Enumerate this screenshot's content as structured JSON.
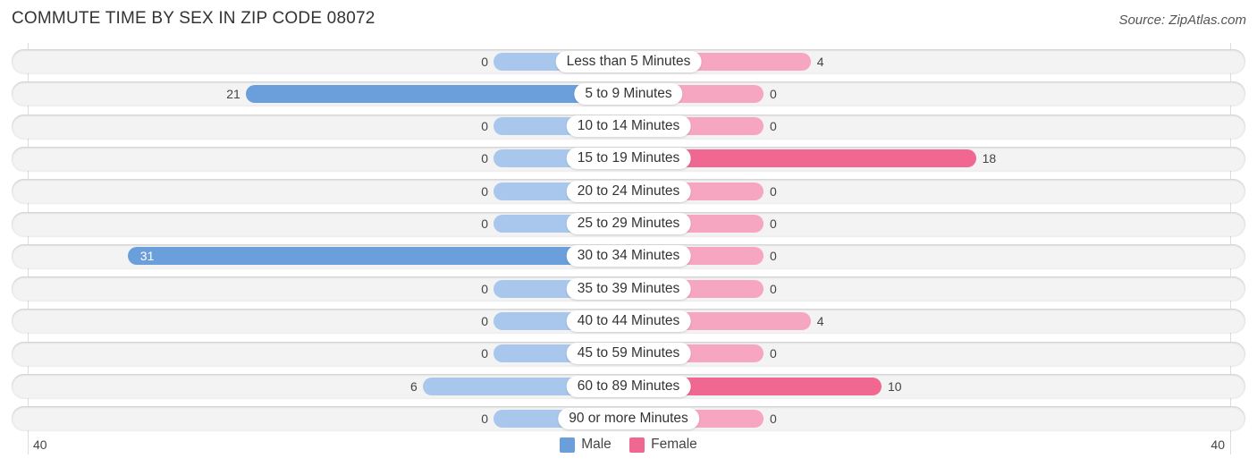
{
  "chart_data": {
    "type": "bar",
    "orientation": "horizontal-diverging",
    "title": "COMMUTE TIME BY SEX IN ZIP CODE 08072",
    "source": "Source: ZipAtlas.com",
    "categories": [
      "Less than 5 Minutes",
      "5 to 9 Minutes",
      "10 to 14 Minutes",
      "15 to 19 Minutes",
      "20 to 24 Minutes",
      "25 to 29 Minutes",
      "30 to 34 Minutes",
      "35 to 39 Minutes",
      "40 to 44 Minutes",
      "45 to 59 Minutes",
      "60 to 89 Minutes",
      "90 or more Minutes"
    ],
    "series": [
      {
        "name": "Male",
        "color": "#6a9fdc",
        "values": [
          0,
          21,
          0,
          0,
          0,
          0,
          31,
          0,
          0,
          0,
          6,
          0
        ]
      },
      {
        "name": "Female",
        "color": "#f06892",
        "values": [
          4,
          0,
          0,
          18,
          0,
          0,
          0,
          0,
          4,
          0,
          10,
          0
        ]
      }
    ],
    "axis": {
      "left_label": "40",
      "right_label": "40",
      "max": 40
    },
    "legend": {
      "position": "bottom-center",
      "entries": [
        "Male",
        "Female"
      ]
    }
  }
}
